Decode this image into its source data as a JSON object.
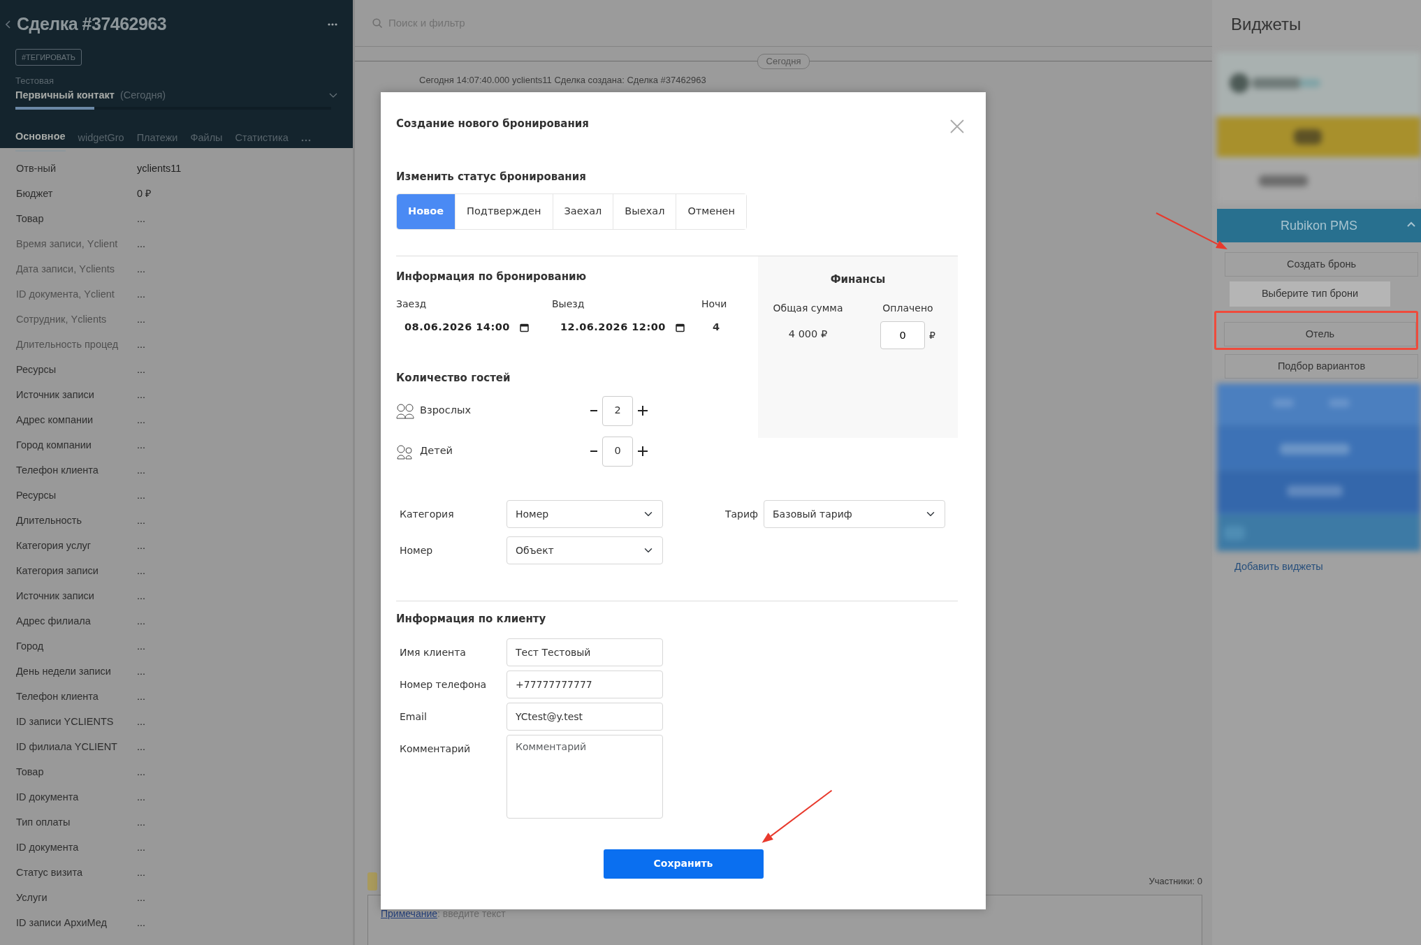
{
  "deal": {
    "title": "Сделка #37462963",
    "tag_button": "#ТЕГИРОВАТЬ",
    "pipeline": "Тестовая",
    "stage": "Первичный контакт",
    "stage_date": "(Сегодня)",
    "stage_progress": {
      "level": 0.25
    },
    "tabs": [
      {
        "label": "Основное",
        "selected": true
      },
      {
        "label": "widgetGro",
        "selected": false
      },
      {
        "label": "Платежи",
        "selected": false
      },
      {
        "label": "Файлы",
        "selected": false
      },
      {
        "label": "Статистика",
        "selected": false
      }
    ],
    "fields": [
      {
        "label": "Отв-ный",
        "value": "yclients11",
        "muted": false
      },
      {
        "label": "Бюджет",
        "value": "0 ₽",
        "muted": false
      },
      {
        "label": "Товар",
        "value": "...",
        "muted": false
      },
      {
        "label": "Время записи, Yclient",
        "value": "...",
        "muted": true
      },
      {
        "label": "Дата записи, Yclients",
        "value": "...",
        "muted": true
      },
      {
        "label": "ID документа, Yclient",
        "value": "...",
        "muted": true
      },
      {
        "label": "Сотрудник, Yclients",
        "value": "...",
        "muted": true
      },
      {
        "label": "Длительность процед",
        "value": "...",
        "muted": true
      },
      {
        "label": "Ресурсы",
        "value": "...",
        "muted": false
      },
      {
        "label": "Источник записи",
        "value": "...",
        "muted": false
      },
      {
        "label": "Адрес компании",
        "value": "...",
        "muted": false
      },
      {
        "label": "Город компании",
        "value": "...",
        "muted": false
      },
      {
        "label": "Телефон клиента",
        "value": "...",
        "muted": false
      },
      {
        "label": "Ресурсы",
        "value": "...",
        "muted": false
      },
      {
        "label": "Длительность",
        "value": "...",
        "muted": false
      },
      {
        "label": "Категория услуг",
        "value": "...",
        "muted": false
      },
      {
        "label": "Категория записи",
        "value": "...",
        "muted": false
      },
      {
        "label": "Источник записи",
        "value": "...",
        "muted": false
      },
      {
        "label": "Адрес филиала",
        "value": "...",
        "muted": false
      },
      {
        "label": "Город",
        "value": "...",
        "muted": false
      },
      {
        "label": "День недели записи",
        "value": "...",
        "muted": false
      },
      {
        "label": "Телефон клиента",
        "value": "...",
        "muted": false
      },
      {
        "label": "ID записи YCLIENTS",
        "value": "...",
        "muted": false
      },
      {
        "label": "ID филиала YCLIENT",
        "value": "...",
        "muted": false
      },
      {
        "label": "Товар",
        "value": "...",
        "muted": false
      },
      {
        "label": "ID документа",
        "value": "...",
        "muted": false
      },
      {
        "label": "Тип оплаты",
        "value": "...",
        "muted": false
      },
      {
        "label": "ID документа",
        "value": "...",
        "muted": false
      },
      {
        "label": "Статус визита",
        "value": "...",
        "muted": false
      },
      {
        "label": "Услуги",
        "value": "...",
        "muted": false
      },
      {
        "label": "ID записи АрхиМед",
        "value": "...",
        "muted": false
      }
    ]
  },
  "feed": {
    "search": {
      "placeholder": "Поиск и фильтр"
    },
    "date_divider": "Сегодня",
    "events": [
      "Сегодня 14:07:40.000 yclients11 Сделка создана: Сделка #37462963"
    ],
    "participants": "Участники: 0",
    "note": {
      "link": "Примечание",
      "placeholder": ": введите текст"
    }
  },
  "modal": {
    "title": "Создание нового бронирования",
    "status_heading": "Изменить статус бронирования",
    "statuses": [
      {
        "label": "Новое",
        "selected": true
      },
      {
        "label": "Подтвержден",
        "selected": false
      },
      {
        "label": "Заехал",
        "selected": false
      },
      {
        "label": "Выехал",
        "selected": false
      },
      {
        "label": "Отменен",
        "selected": false
      }
    ],
    "booking_heading": "Информация по бронированию",
    "dates": [
      {
        "label": "Заезд",
        "value": "08.06.2026 14:00"
      },
      {
        "label": "Выезд",
        "value": "12.06.2026 12:00"
      }
    ],
    "nights": {
      "label": "Ночи",
      "value": "4"
    },
    "guests_heading": "Количество гостей",
    "guests": [
      {
        "label": "Взрослых",
        "value": "2",
        "kind": "adult"
      },
      {
        "label": "Детей",
        "value": "0",
        "kind": "child"
      }
    ],
    "finance": {
      "title": "Финансы",
      "total_label": "Общая сумма",
      "total": "4 000 ₽",
      "paid_label": "Оплачено",
      "paid": "0",
      "currency": "₽"
    },
    "selects": [
      {
        "label": "Категория",
        "value": "Номер"
      },
      {
        "label": "Номер",
        "value": "Объект"
      }
    ],
    "tariff": {
      "label": "Тариф",
      "value": "Базовый тариф"
    },
    "client_heading": "Информация по клиенту",
    "client_fields": [
      {
        "label": "Имя клиента",
        "value": "Тест Тестовый",
        "kind": "input"
      },
      {
        "label": "Номер телефона",
        "value": "+77777777777",
        "kind": "input"
      },
      {
        "label": "Email",
        "value": "YCtest@y.test",
        "kind": "input"
      },
      {
        "label": "Комментарий",
        "placeholder": "Комментарий",
        "kind": "textarea"
      }
    ],
    "save_button": {
      "label": "Сохранить",
      "arrow": true
    }
  },
  "widgets": {
    "title": "Виджеты",
    "panel": {
      "title": "Rubikon PMS",
      "expanded": true
    },
    "items": [
      {
        "label": "Создать бронь",
        "kind": "button",
        "highlighted": false,
        "arrow": true
      },
      {
        "label": "Выберите тип брони",
        "kind": "header",
        "highlighted": false,
        "arrow": false
      },
      {
        "label": "Отель",
        "kind": "button",
        "highlighted": true,
        "arrow": false
      },
      {
        "label": "Подбор вариантов",
        "kind": "button",
        "highlighted": false,
        "arrow": false
      }
    ],
    "add_link": "Добавить виджеты"
  }
}
